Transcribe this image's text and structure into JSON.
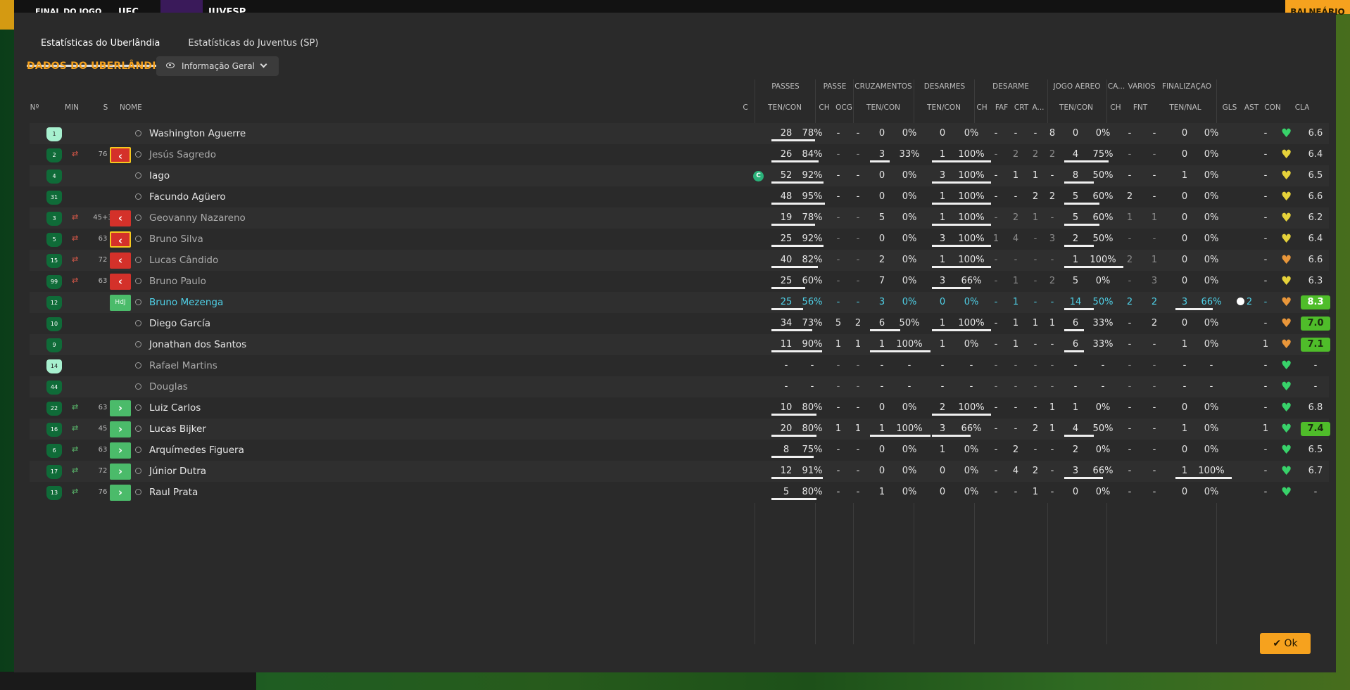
{
  "topbar": {
    "status": "FINAL DO JOGO",
    "team1": "UFC",
    "team2": "JUVESP",
    "right_button": "BALNEÁRIO"
  },
  "tabs": [
    "Estatísticas do Uberlândia",
    "Estatísticas do Juventus (SP)"
  ],
  "section_title": "DADOS DO UBERLÂNDIA",
  "dropdown": {
    "label": "Informação Geral"
  },
  "group_headers": [
    "PASSES",
    "PASSE",
    "CRUZAMENTOS",
    "DESARMES",
    "DESARME",
    "JOGO AÉREO",
    "CA...",
    "VÁRIOS",
    "FINALIZAÇÃO"
  ],
  "col_headers": [
    "Nº",
    "MIN",
    "S",
    "NOME",
    "C",
    "TEN/CON",
    "CH",
    "OCG",
    "TEN/CON",
    "TEN/CON",
    "CH",
    "FAF",
    "CRT",
    "A...",
    "TEN/CON",
    "CH",
    "FNT",
    "TEN/NAL",
    "GLS",
    "AST",
    "CON",
    "CLA"
  ],
  "colors": {
    "accent": "#f6a21e",
    "panel": "#2a2a2a",
    "rating_green": "#4fbd2a",
    "heart_green": "#38d26a",
    "heart_yellow": "#e6d23a",
    "heart_orange": "#e8963a"
  },
  "players": [
    {
      "num": "1",
      "gk": true,
      "sub": "",
      "min": "",
      "badge": "",
      "name": "Washington Aguerre",
      "dim": false,
      "cap": false,
      "vals": [
        "28",
        "78%",
        "-",
        "-",
        "0",
        "0%",
        "0",
        "0%",
        "-",
        "-",
        "-",
        "8",
        "0",
        "0%",
        "-",
        "-",
        "0",
        "0%",
        "",
        "-",
        ""
      ],
      "pass_frac": 0.78,
      "cruz_frac": 0,
      "des_frac": 0,
      "air_frac": 0,
      "fin_frac": 0,
      "heart": "green",
      "cla": "6.6",
      "cla_hi": false
    },
    {
      "num": "2",
      "gk": false,
      "sub": "out",
      "min": "76",
      "badge": "out-y",
      "name": "Jesús Sagredo",
      "dim": true,
      "cap": false,
      "vals": [
        "26",
        "84%",
        "-",
        "-",
        "3",
        "33%",
        "1",
        "100%",
        "-",
        "2",
        "2",
        "2",
        "4",
        "75%",
        "-",
        "-",
        "0",
        "0%",
        "",
        "-",
        ""
      ],
      "pass_frac": 0.84,
      "cruz_frac": 0.33,
      "des_frac": 1,
      "air_frac": 0.75,
      "fin_frac": 0,
      "heart": "yellow",
      "cla": "6.4",
      "cla_hi": false
    },
    {
      "num": "4",
      "gk": false,
      "sub": "",
      "min": "",
      "badge": "",
      "name": "Iago",
      "dim": false,
      "cap": true,
      "vals": [
        "52",
        "92%",
        "-",
        "-",
        "0",
        "0%",
        "3",
        "100%",
        "-",
        "1",
        "1",
        "-",
        "8",
        "50%",
        "-",
        "-",
        "1",
        "0%",
        "",
        "-",
        ""
      ],
      "pass_frac": 0.92,
      "cruz_frac": 0,
      "des_frac": 1,
      "air_frac": 0.5,
      "fin_frac": 0,
      "heart": "yellow",
      "cla": "6.5",
      "cla_hi": false
    },
    {
      "num": "31",
      "gk": false,
      "sub": "",
      "min": "",
      "badge": "",
      "name": "Facundo Agüero",
      "dim": false,
      "cap": false,
      "vals": [
        "48",
        "95%",
        "-",
        "-",
        "0",
        "0%",
        "1",
        "100%",
        "-",
        "-",
        "2",
        "2",
        "5",
        "60%",
        "2",
        "-",
        "0",
        "0%",
        "",
        "-",
        ""
      ],
      "pass_frac": 0.95,
      "cruz_frac": 0,
      "des_frac": 1,
      "air_frac": 0.6,
      "fin_frac": 0,
      "heart": "yellow",
      "cla": "6.6",
      "cla_hi": false
    },
    {
      "num": "3",
      "gk": false,
      "sub": "out",
      "min": "45+3",
      "badge": "out",
      "name": "Geovanny Nazareno",
      "dim": true,
      "cap": false,
      "vals": [
        "19",
        "78%",
        "-",
        "-",
        "5",
        "0%",
        "1",
        "100%",
        "-",
        "2",
        "1",
        "-",
        "5",
        "60%",
        "1",
        "1",
        "0",
        "0%",
        "",
        "-",
        ""
      ],
      "pass_frac": 0.78,
      "cruz_frac": 0,
      "des_frac": 1,
      "air_frac": 0.6,
      "fin_frac": 0,
      "heart": "yellow",
      "cla": "6.2",
      "cla_hi": false
    },
    {
      "num": "5",
      "gk": false,
      "sub": "out",
      "min": "63",
      "badge": "out-y",
      "name": "Bruno Silva",
      "dim": true,
      "cap": false,
      "vals": [
        "25",
        "92%",
        "-",
        "-",
        "0",
        "0%",
        "3",
        "100%",
        "1",
        "4",
        "-",
        "3",
        "2",
        "50%",
        "-",
        "-",
        "0",
        "0%",
        "",
        "-",
        ""
      ],
      "pass_frac": 0.92,
      "cruz_frac": 0,
      "des_frac": 1,
      "air_frac": 0.5,
      "fin_frac": 0,
      "heart": "yellow",
      "cla": "6.4",
      "cla_hi": false
    },
    {
      "num": "15",
      "gk": false,
      "sub": "out",
      "min": "72",
      "badge": "out",
      "name": "Lucas Cândido",
      "dim": true,
      "cap": false,
      "vals": [
        "40",
        "82%",
        "-",
        "-",
        "2",
        "0%",
        "1",
        "100%",
        "-",
        "-",
        "-",
        "-",
        "1",
        "100%",
        "2",
        "1",
        "0",
        "0%",
        "",
        "-",
        ""
      ],
      "pass_frac": 0.82,
      "cruz_frac": 0,
      "des_frac": 1,
      "air_frac": 1,
      "fin_frac": 0,
      "heart": "orange",
      "cla": "6.6",
      "cla_hi": false
    },
    {
      "num": "99",
      "gk": false,
      "sub": "out",
      "min": "63",
      "badge": "out",
      "name": "Bruno Paulo",
      "dim": true,
      "cap": false,
      "vals": [
        "25",
        "60%",
        "-",
        "-",
        "7",
        "0%",
        "3",
        "66%",
        "-",
        "1",
        "-",
        "2",
        "5",
        "0%",
        "-",
        "3",
        "0",
        "0%",
        "",
        "-",
        ""
      ],
      "pass_frac": 0.6,
      "cruz_frac": 0,
      "des_frac": 0.66,
      "air_frac": 0,
      "fin_frac": 0,
      "heart": "yellow",
      "cla": "6.3",
      "cla_hi": false
    },
    {
      "num": "12",
      "gk": false,
      "sub": "",
      "min": "",
      "badge": "potm",
      "name": "Bruno Mezenga",
      "dim": false,
      "potm": true,
      "cap": false,
      "vals": [
        "25",
        "56%",
        "-",
        "-",
        "3",
        "0%",
        "0",
        "0%",
        "-",
        "1",
        "-",
        "-",
        "14",
        "50%",
        "2",
        "2",
        "3",
        "66%",
        "2",
        "-",
        ""
      ],
      "pass_frac": 0.56,
      "cruz_frac": 0,
      "des_frac": 0,
      "air_frac": 0.5,
      "fin_frac": 0.66,
      "heart": "orange",
      "cla": "8.3",
      "cla_hi": true
    },
    {
      "num": "10",
      "gk": false,
      "sub": "",
      "min": "",
      "badge": "",
      "name": "Diego García",
      "dim": false,
      "cap": false,
      "vals": [
        "34",
        "73%",
        "5",
        "2",
        "6",
        "50%",
        "1",
        "100%",
        "-",
        "1",
        "1",
        "1",
        "6",
        "33%",
        "-",
        "2",
        "0",
        "0%",
        "",
        "-",
        ""
      ],
      "pass_frac": 0.73,
      "cruz_frac": 0.5,
      "des_frac": 1,
      "air_frac": 0.33,
      "fin_frac": 0,
      "heart": "orange",
      "cla": "7.0",
      "cla_hi": true
    },
    {
      "num": "9",
      "gk": false,
      "sub": "",
      "min": "",
      "badge": "",
      "name": "Jonathan dos Santos",
      "dim": false,
      "cap": false,
      "vals": [
        "11",
        "90%",
        "1",
        "1",
        "1",
        "100%",
        "1",
        "0%",
        "-",
        "1",
        "-",
        "-",
        "6",
        "33%",
        "-",
        "-",
        "1",
        "0%",
        "",
        "1",
        ""
      ],
      "pass_frac": 0.9,
      "cruz_frac": 1,
      "des_frac": 0,
      "air_frac": 0.33,
      "fin_frac": 0,
      "heart": "orange",
      "cla": "7.1",
      "cla_hi": true
    },
    {
      "num": "14",
      "gk": true,
      "sub": "",
      "min": "",
      "badge": "",
      "name": "Rafael Martins",
      "dim": true,
      "cap": false,
      "vals": [
        "-",
        "-",
        "-",
        "-",
        "-",
        "-",
        "-",
        "-",
        "-",
        "-",
        "-",
        "-",
        "-",
        "-",
        "-",
        "-",
        "-",
        "-",
        "",
        "-",
        ""
      ],
      "pass_frac": 0,
      "cruz_frac": 0,
      "des_frac": 0,
      "air_frac": 0,
      "fin_frac": 0,
      "heart": "green",
      "cla": "-",
      "cla_hi": false
    },
    {
      "num": "44",
      "gk": false,
      "sub": "",
      "min": "",
      "badge": "",
      "name": "Douglas",
      "dim": true,
      "cap": false,
      "vals": [
        "-",
        "-",
        "-",
        "-",
        "-",
        "-",
        "-",
        "-",
        "-",
        "-",
        "-",
        "-",
        "-",
        "-",
        "-",
        "-",
        "-",
        "-",
        "",
        "-",
        ""
      ],
      "pass_frac": 0,
      "cruz_frac": 0,
      "des_frac": 0,
      "air_frac": 0,
      "fin_frac": 0,
      "heart": "green",
      "cla": "-",
      "cla_hi": false
    },
    {
      "num": "22",
      "gk": false,
      "sub": "in",
      "min": "63",
      "badge": "in",
      "name": "Luiz Carlos",
      "dim": false,
      "cap": false,
      "vals": [
        "10",
        "80%",
        "-",
        "-",
        "0",
        "0%",
        "2",
        "100%",
        "-",
        "-",
        "-",
        "1",
        "1",
        "0%",
        "-",
        "-",
        "0",
        "0%",
        "",
        "-",
        ""
      ],
      "pass_frac": 0.8,
      "cruz_frac": 0,
      "des_frac": 1,
      "air_frac": 0,
      "fin_frac": 0,
      "heart": "green",
      "cla": "6.8",
      "cla_hi": false
    },
    {
      "num": "16",
      "gk": false,
      "sub": "in",
      "min": "45",
      "badge": "in",
      "name": "Lucas Bijker",
      "dim": false,
      "cap": false,
      "vals": [
        "20",
        "80%",
        "1",
        "1",
        "1",
        "100%",
        "3",
        "66%",
        "-",
        "-",
        "2",
        "1",
        "4",
        "50%",
        "-",
        "-",
        "1",
        "0%",
        "",
        "1",
        ""
      ],
      "pass_frac": 0.8,
      "cruz_frac": 1,
      "des_frac": 0.66,
      "air_frac": 0.5,
      "fin_frac": 0,
      "heart": "green",
      "cla": "7.4",
      "cla_hi": true
    },
    {
      "num": "6",
      "gk": false,
      "sub": "in",
      "min": "63",
      "badge": "in",
      "name": "Arquímedes Figuera",
      "dim": false,
      "cap": false,
      "vals": [
        "8",
        "75%",
        "-",
        "-",
        "0",
        "0%",
        "1",
        "0%",
        "-",
        "2",
        "-",
        "-",
        "2",
        "0%",
        "-",
        "-",
        "0",
        "0%",
        "",
        "-",
        ""
      ],
      "pass_frac": 0.75,
      "cruz_frac": 0,
      "des_frac": 0,
      "air_frac": 0,
      "fin_frac": 0,
      "heart": "green",
      "cla": "6.5",
      "cla_hi": false
    },
    {
      "num": "17",
      "gk": false,
      "sub": "in",
      "min": "72",
      "badge": "in",
      "name": "Júnior Dutra",
      "dim": false,
      "cap": false,
      "vals": [
        "12",
        "91%",
        "-",
        "-",
        "0",
        "0%",
        "0",
        "0%",
        "-",
        "4",
        "2",
        "-",
        "3",
        "66%",
        "-",
        "-",
        "1",
        "100%",
        "",
        "-",
        ""
      ],
      "pass_frac": 0.91,
      "cruz_frac": 0,
      "des_frac": 0,
      "air_frac": 0.66,
      "fin_frac": 1,
      "heart": "green",
      "cla": "6.7",
      "cla_hi": false
    },
    {
      "num": "13",
      "gk": false,
      "sub": "in",
      "min": "76",
      "badge": "in",
      "name": "Raul Prata",
      "dim": false,
      "cap": false,
      "vals": [
        "5",
        "80%",
        "-",
        "-",
        "1",
        "0%",
        "0",
        "0%",
        "-",
        "-",
        "1",
        "-",
        "0",
        "0%",
        "-",
        "-",
        "0",
        "0%",
        "",
        "-",
        ""
      ],
      "pass_frac": 0.8,
      "cruz_frac": 0,
      "des_frac": 0,
      "air_frac": 0,
      "fin_frac": 0,
      "heart": "green",
      "cla": "-",
      "cla_hi": false
    }
  ],
  "ok_label": "Ok"
}
